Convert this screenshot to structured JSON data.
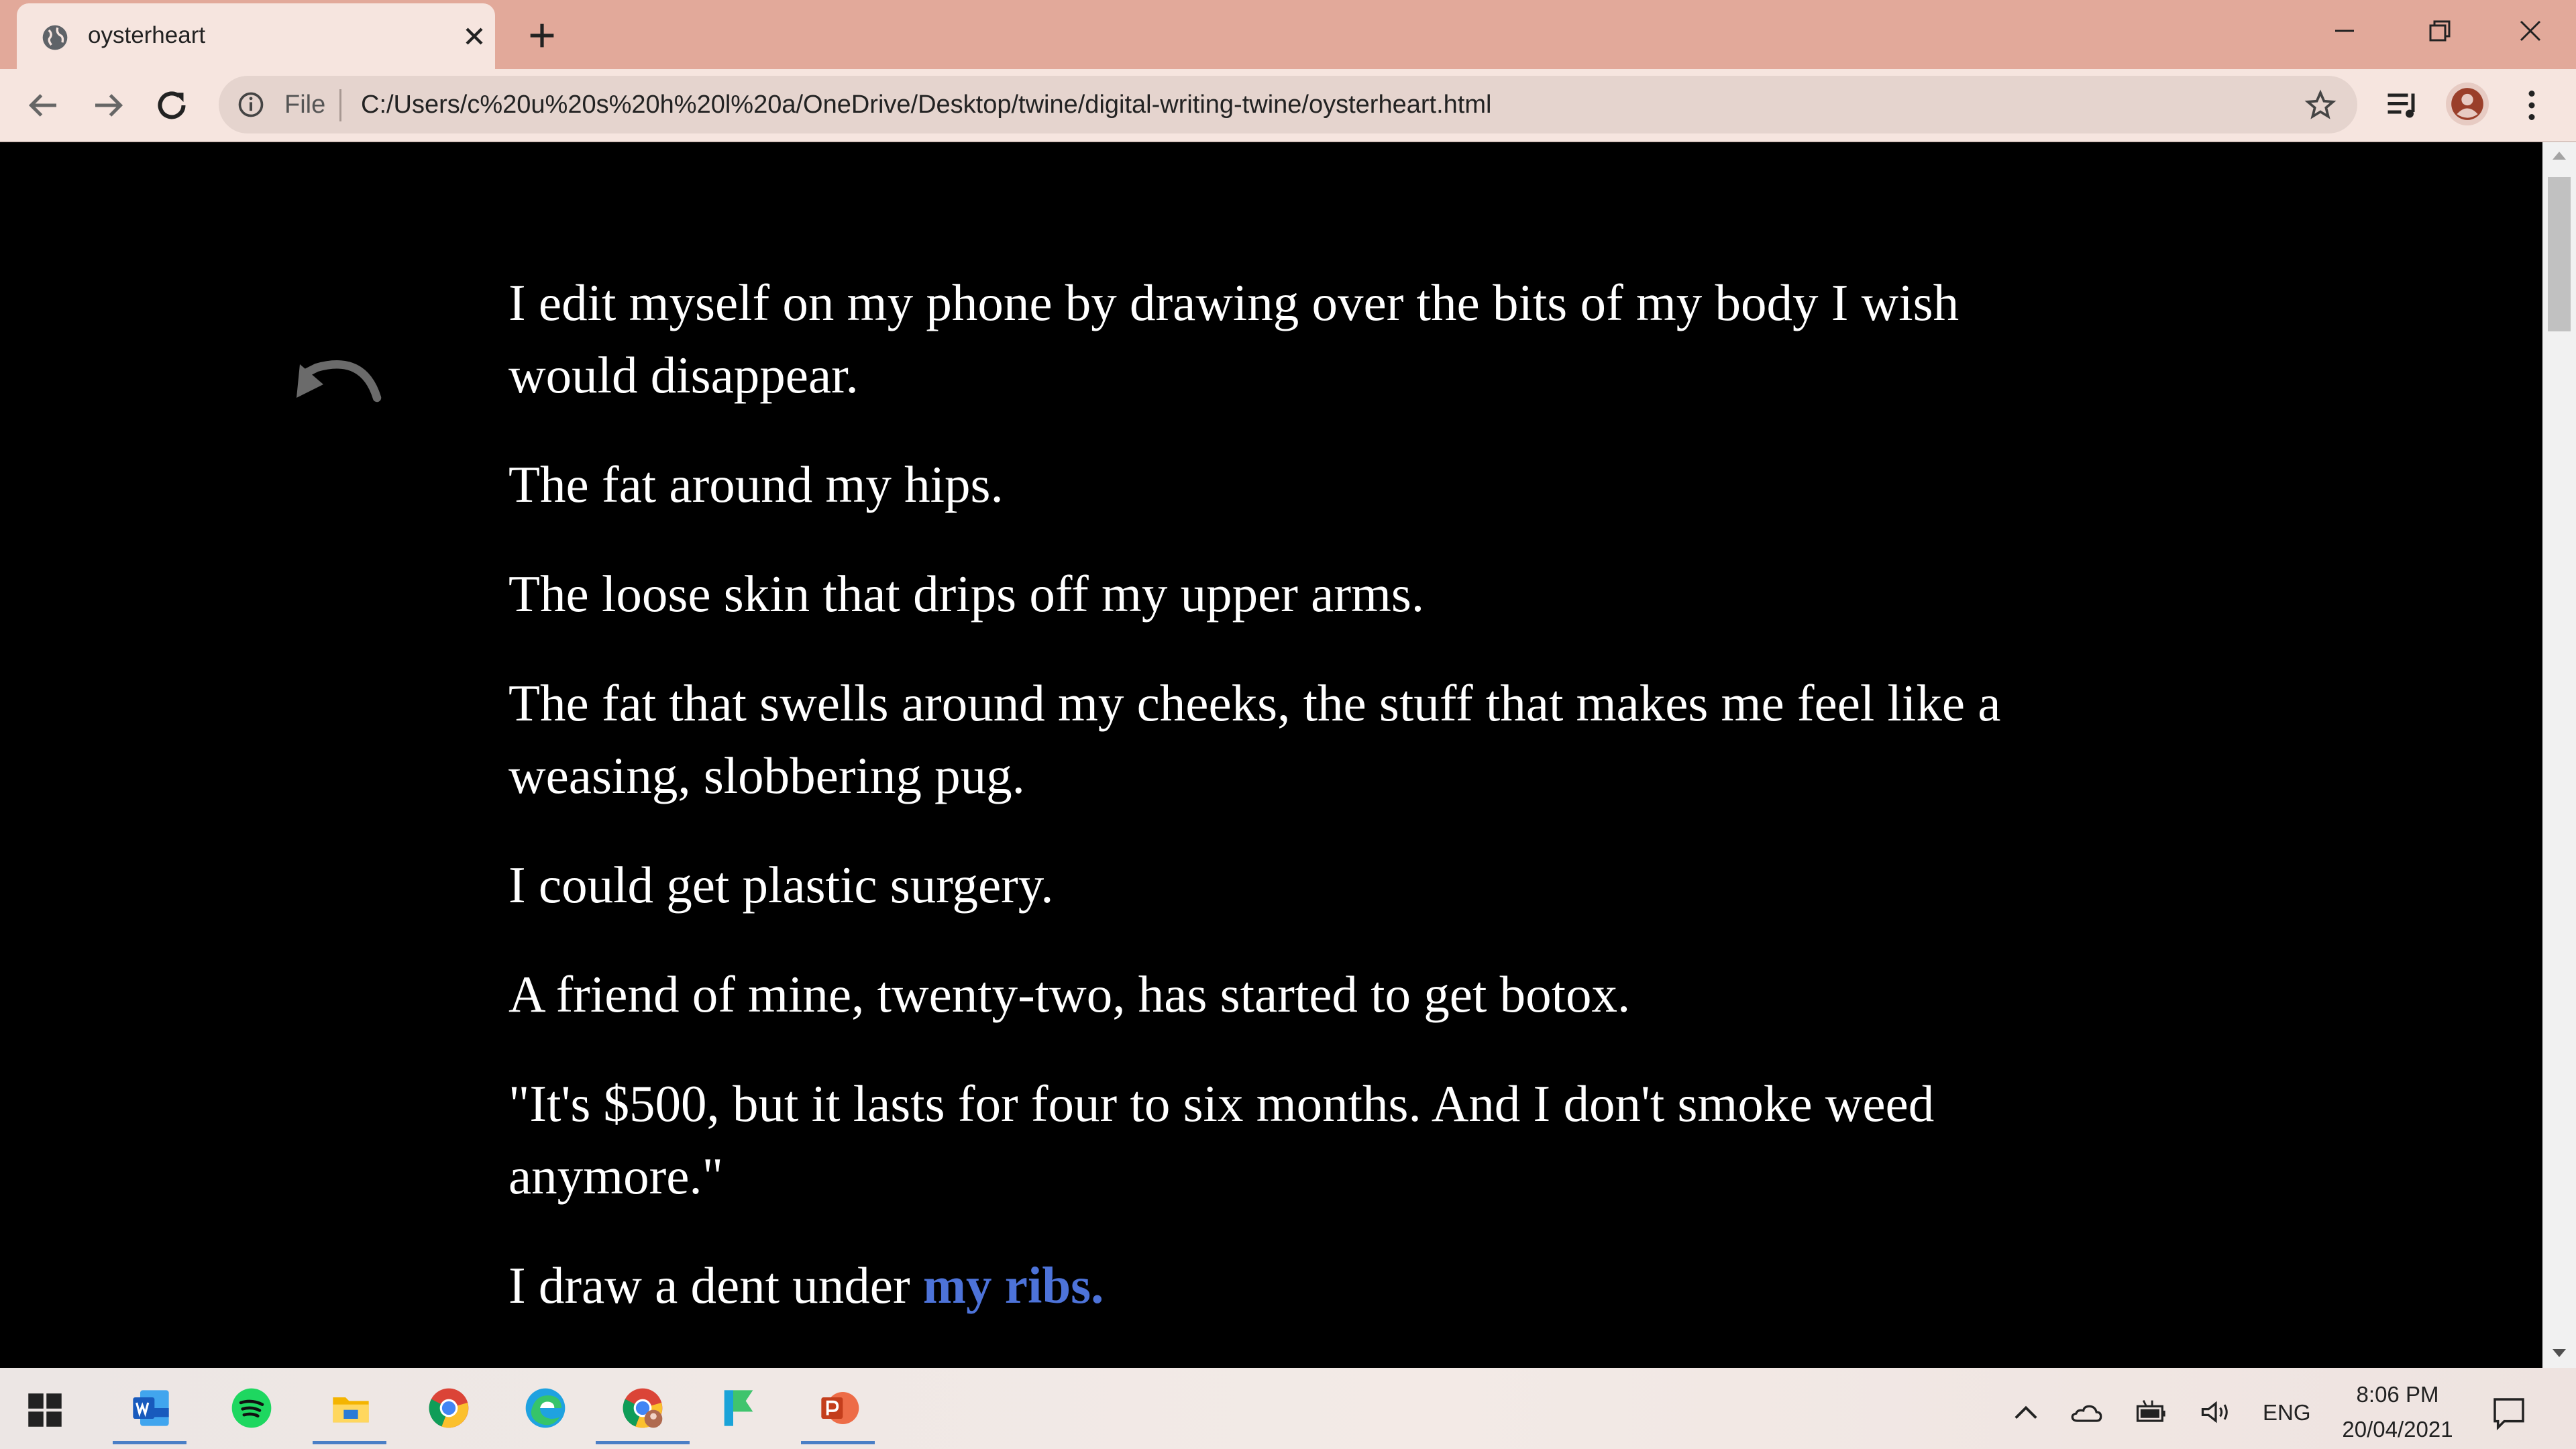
{
  "browser": {
    "tab_title": "oysterheart",
    "address_scheme_label": "File",
    "url": "C:/Users/c%20u%20s%20h%20l%20a/OneDrive/Desktop/twine/digital-writing-twine/oysterheart.html"
  },
  "passage": {
    "paragraphs": [
      "I edit myself on my phone by drawing over the bits of my body I wish would disappear.",
      "The fat around my hips.",
      "The loose skin that drips off my upper arms.",
      "The fat that swells around my cheeks, the stuff that makes me feel like a weasing, slobbering pug.",
      "I could get plastic surgery.",
      "A friend of mine, twenty-two, has started to get botox.",
      "\"It's $500, but it lasts for four to six months. And I don't smoke weed anymore.\""
    ],
    "last_line_prefix": "I draw a dent under ",
    "last_line_link": "my ribs.",
    "link_color": "#4d73d9",
    "undo_icon": "undo-arrow-icon"
  },
  "taskbar": {
    "apps": [
      "word-icon",
      "spotify-icon",
      "file-explorer-icon",
      "chrome-icon",
      "edge-icon",
      "chrome-profile-icon",
      "bookmark-app-icon",
      "powerpoint-icon"
    ],
    "language": "ENG",
    "time": "8:06 PM",
    "date": "20/04/2021"
  },
  "colors": {
    "tabstrip": "#e2a99a",
    "toolbar": "#f6e5df",
    "page_background": "#000000",
    "text": "#ffffff"
  }
}
